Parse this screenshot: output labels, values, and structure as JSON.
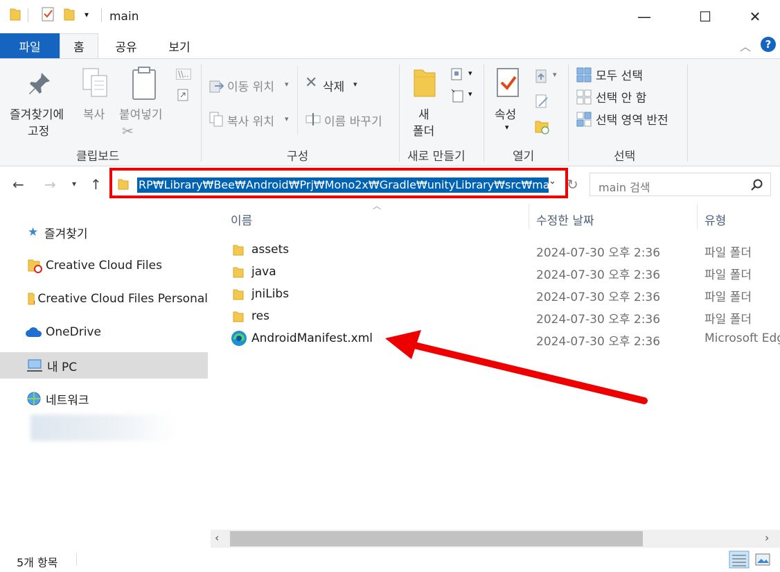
{
  "window": {
    "title": "main",
    "controls": {
      "minimize": "—",
      "maximize": "☐",
      "close": "✕"
    }
  },
  "ribbon": {
    "tabs": [
      {
        "label": "파일"
      },
      {
        "label": "홈"
      },
      {
        "label": "공유"
      },
      {
        "label": "보기"
      }
    ],
    "help_glyph": "?",
    "clipboard": {
      "pin": [
        "즐겨찾기에",
        "고정"
      ],
      "copy": "복사",
      "paste": "붙여넣기",
      "group": "클립보드"
    },
    "organize": {
      "move_to": "이동 위치",
      "copy_to": "복사 위치",
      "delete": "삭제",
      "rename": "이름 바꾸기",
      "group": "구성"
    },
    "new": {
      "folder": [
        "새",
        "폴더"
      ],
      "group": "새로 만들기"
    },
    "open": {
      "properties": "속성",
      "group": "열기"
    },
    "select": {
      "all": "모두 선택",
      "none": "선택 안 함",
      "invert": "선택 영역 반전",
      "group": "선택"
    }
  },
  "address": {
    "path": "RP₩Library₩Bee₩Android₩Prj₩Mono2x₩Gradle₩unityLibrary₩src₩main",
    "search_placeholder": "main 검색"
  },
  "nav_pane": {
    "items": [
      {
        "label": "즐겨찾기",
        "icon": "star-icon"
      },
      {
        "label": "Creative Cloud Files",
        "icon": "creative-cloud-folder-icon"
      },
      {
        "label": "Creative Cloud Files Personal",
        "icon": "creative-cloud-folder-icon"
      },
      {
        "label": "OneDrive",
        "icon": "cloud-icon"
      },
      {
        "label": "내 PC",
        "icon": "computer-icon",
        "selected": true
      },
      {
        "label": "네트워크",
        "icon": "network-icon"
      }
    ]
  },
  "file_list": {
    "columns": {
      "name": "이름",
      "date": "수정한 날짜",
      "type": "유형"
    },
    "rows": [
      {
        "name": "assets",
        "date": "2024-07-30 오후 2:36",
        "type": "파일 폴더",
        "icon": "folder-icon"
      },
      {
        "name": "java",
        "date": "2024-07-30 오후 2:36",
        "type": "파일 폴더",
        "icon": "folder-icon"
      },
      {
        "name": "jniLibs",
        "date": "2024-07-30 오후 2:36",
        "type": "파일 폴더",
        "icon": "folder-icon"
      },
      {
        "name": "res",
        "date": "2024-07-30 오후 2:36",
        "type": "파일 폴더",
        "icon": "folder-icon"
      },
      {
        "name": "AndroidManifest.xml",
        "date": "2024-07-30 오후 2:36",
        "type": "Microsoft Edg",
        "icon": "edge-icon"
      }
    ]
  },
  "status": {
    "items": "5개 항목"
  },
  "colors": {
    "accent": "#1565c0",
    "highlight": "#0063b1",
    "annotation": "#e00000"
  }
}
